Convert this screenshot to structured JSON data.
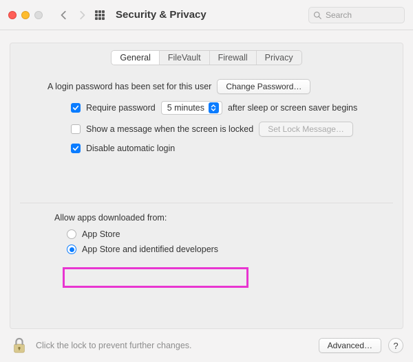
{
  "window": {
    "title": "Security & Privacy",
    "search_placeholder": "Search"
  },
  "tabs": {
    "general": "General",
    "filevault": "FileVault",
    "firewall": "Firewall",
    "privacy": "Privacy"
  },
  "general": {
    "login_password_text": "A login password has been set for this user",
    "change_password_btn": "Change Password…",
    "require_password_label": "Require password",
    "require_password_select": "5 minutes",
    "require_password_suffix": "after sleep or screen saver begins",
    "show_message_label": "Show a message when the screen is locked",
    "set_lock_message_btn": "Set Lock Message…",
    "disable_auto_login_label": "Disable automatic login"
  },
  "allow": {
    "section_label": "Allow apps downloaded from:",
    "opt_appstore": "App Store",
    "opt_appstore_identified": "App Store and identified developers"
  },
  "footer": {
    "lock_text": "Click the lock to prevent further changes.",
    "advanced_btn": "Advanced…",
    "help": "?"
  }
}
